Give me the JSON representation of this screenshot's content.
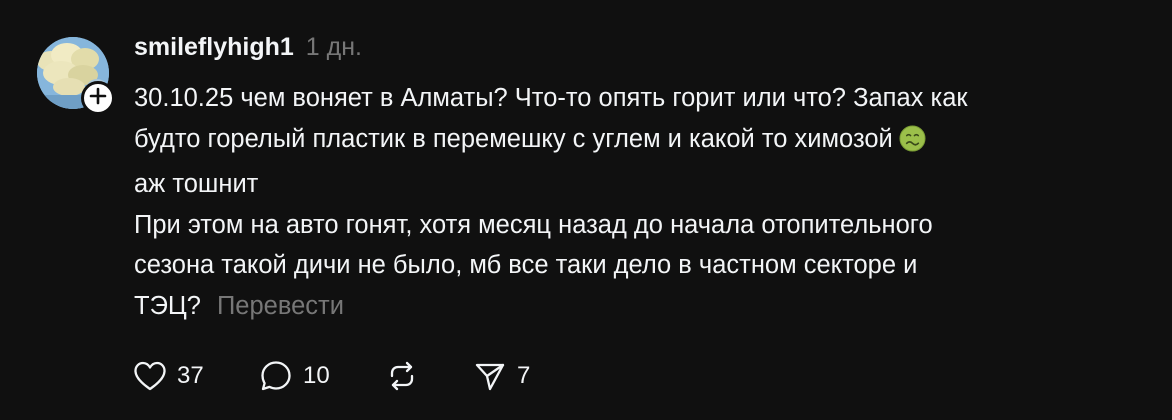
{
  "post": {
    "username": "smileflyhigh1",
    "timestamp": "1 дн.",
    "lines": [
      "30.10.25 чем воняет в Алматы? Что-то опять горит или что? Запах как",
      "будто горелый пластик в перемешку с углем и какой то химозой",
      "аж тошнит",
      "При этом на авто гонят, хотя месяц назад до начала отопительного",
      "сезона такой дичи не было, мб все таки дело в частном секторе и",
      "ТЭЦ?"
    ],
    "emoji": "nauseated-face-emoji",
    "translate_label": "Перевести",
    "avatar_icon": "sky-clouds-avatar",
    "follow_icon": "plus-icon"
  },
  "actions": {
    "like_count": "37",
    "reply_count": "10",
    "repost_count": "",
    "share_count": "7",
    "icons": [
      "heart-icon",
      "comment-icon",
      "repost-icon",
      "share-icon"
    ]
  },
  "colors": {
    "background": "#101010",
    "text": "#f3f5f7",
    "muted": "#777777"
  }
}
